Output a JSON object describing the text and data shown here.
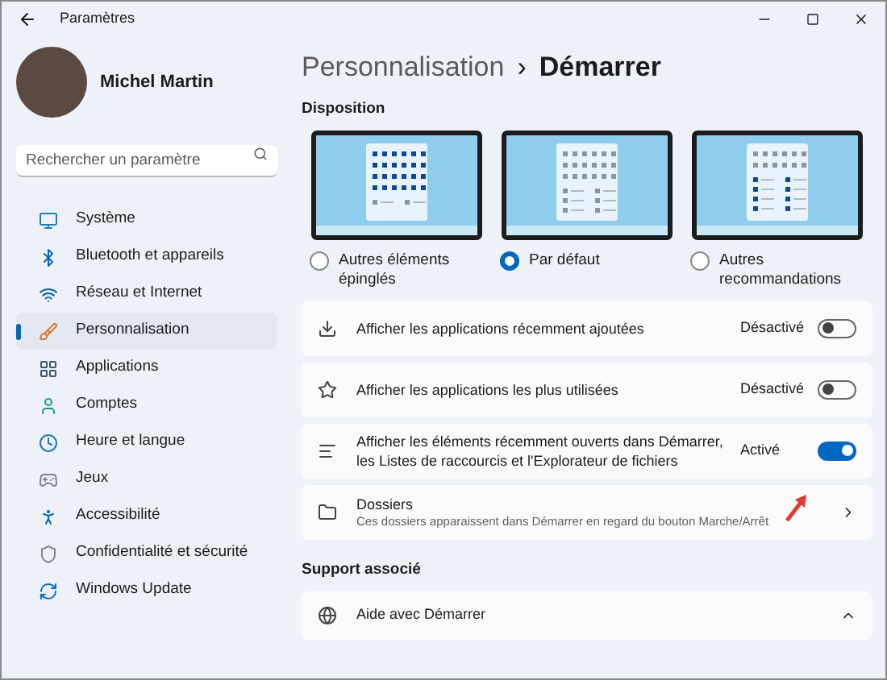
{
  "window": {
    "title": "Paramètres"
  },
  "user": {
    "name": "Michel Martin"
  },
  "search": {
    "placeholder": "Rechercher un paramètre"
  },
  "sidebar": {
    "items": [
      {
        "label": "Système",
        "selected": false
      },
      {
        "label": "Bluetooth et appareils",
        "selected": false
      },
      {
        "label": "Réseau et Internet",
        "selected": false
      },
      {
        "label": "Personnalisation",
        "selected": true
      },
      {
        "label": "Applications",
        "selected": false
      },
      {
        "label": "Comptes",
        "selected": false
      },
      {
        "label": "Heure et langue",
        "selected": false
      },
      {
        "label": "Jeux",
        "selected": false
      },
      {
        "label": "Accessibilité",
        "selected": false
      },
      {
        "label": "Confidentialité et sécurité",
        "selected": false
      },
      {
        "label": "Windows Update",
        "selected": false
      }
    ]
  },
  "breadcrumb": {
    "parent": "Personnalisation",
    "separator": "›",
    "current": "Démarrer"
  },
  "layout_section": {
    "title": "Disposition",
    "options": [
      {
        "kind": "pinned",
        "label": "Autres éléments épinglés",
        "selected": false
      },
      {
        "kind": "default",
        "label": "Par défaut",
        "selected": true
      },
      {
        "kind": "recommendations",
        "label": "Autres recommandations",
        "selected": false
      }
    ]
  },
  "settings": [
    {
      "kind": "toggle",
      "label": "Afficher les applications récemment ajoutées",
      "status": "Désactivé",
      "on": false
    },
    {
      "kind": "toggle",
      "label": "Afficher les applications les plus utilisées",
      "status": "Désactivé",
      "on": false
    },
    {
      "kind": "toggle",
      "label": "Afficher les éléments récemment ouverts dans Démarrer, les Listes de raccourcis et l'Explorateur de fichiers",
      "status": "Activé",
      "on": true
    },
    {
      "kind": "link",
      "label": "Dossiers",
      "description": "Ces dossiers apparaissent dans Démarrer en regard du bouton Marche/Arrêt"
    }
  ],
  "support_section": {
    "title": "Support associé",
    "items": [
      {
        "label": "Aide avec Démarrer",
        "expanded": true
      }
    ]
  }
}
